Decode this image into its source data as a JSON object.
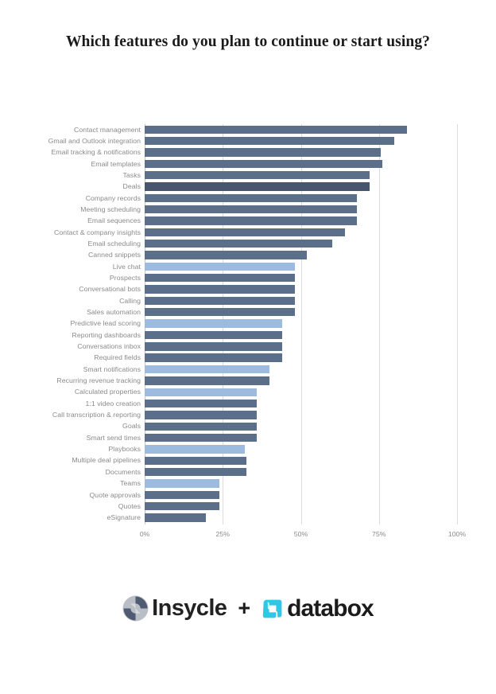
{
  "title": "Which features do you plan to continue or start using?",
  "colors": {
    "bar_default": "#5b6e8a",
    "bar_dark": "#47566d",
    "bar_light": "#9dbbde",
    "gridline": "#dcdcdc",
    "label_text": "#8a8a8a",
    "title_text": "#1a1a1a",
    "databox_cyan": "#2ec8e6"
  },
  "footer": {
    "insycle_label": "Insycle",
    "plus_label": "+",
    "databox_label": "databox",
    "insycle_icon": "insycle-circle-logo-icon",
    "databox_icon": "databox-square-logo-icon"
  },
  "chart_data": {
    "type": "bar",
    "orientation": "horizontal",
    "title": "Which features do you plan to continue or start using?",
    "xlabel": "",
    "ylabel": "",
    "xlim": [
      0,
      100
    ],
    "xticks": [
      "0%",
      "25%",
      "50%",
      "75%",
      "100%"
    ],
    "xtick_values": [
      0,
      25,
      50,
      75,
      100
    ],
    "grid": true,
    "legend": "none",
    "value_unit": "%",
    "categories": [
      "Contact management",
      "Gmail and Outlook integration",
      "Email tracking & notifications",
      "Email templates",
      "Tasks",
      "Deals",
      "Company records",
      "Meeting scheduling",
      "Email sequences",
      "Contact & company insights",
      "Email scheduling",
      "Canned snippets",
      "Live chat",
      "Prospects",
      "Conversational bots",
      "Calling",
      "Sales automation",
      "Predictive lead scoring",
      "Reporting dashboards",
      "Conversations inbox",
      "Required fields",
      "Smart notifications",
      "Recurring revenue tracking",
      "Calculated properties",
      "1:1 video creation",
      "Call transcription & reporting",
      "Goals",
      "Smart send times",
      "Playbooks",
      "Multiple deal pipelines",
      "Documents",
      "Teams",
      "Quote approvals",
      "Quotes",
      "eSignature"
    ],
    "values": [
      84,
      80,
      75.5,
      76,
      72,
      72,
      68,
      68,
      68,
      64,
      60,
      52,
      48,
      48,
      48,
      48,
      48,
      44,
      44,
      44,
      44,
      40,
      40,
      36,
      36,
      36,
      36,
      36,
      32,
      32.5,
      32.5,
      24,
      24,
      24,
      19.5
    ],
    "bar_styles": [
      "default",
      "default",
      "default",
      "default",
      "default",
      "dark",
      "default",
      "default",
      "default",
      "default",
      "default",
      "default",
      "light",
      "default",
      "default",
      "default",
      "default",
      "light",
      "default",
      "default",
      "default",
      "light",
      "default",
      "light",
      "default",
      "default",
      "default",
      "default",
      "light",
      "default",
      "default",
      "light",
      "default",
      "default",
      "default"
    ]
  }
}
